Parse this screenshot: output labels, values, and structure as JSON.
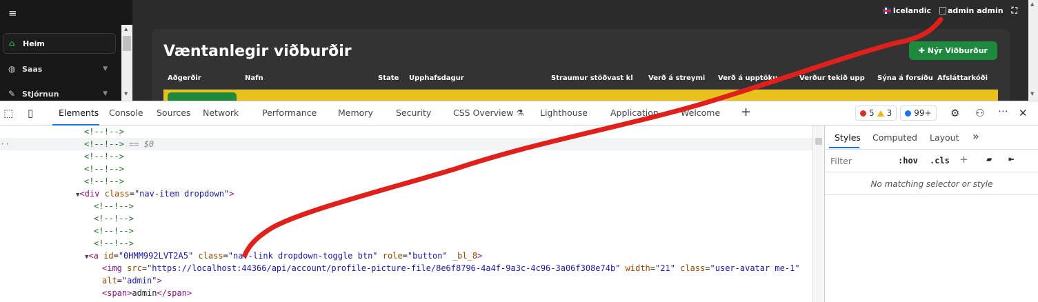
{
  "app": {
    "sidebar": {
      "items": [
        {
          "label": "Heim",
          "icon": "home-icon"
        },
        {
          "label": "Saas",
          "icon": "globe-icon"
        },
        {
          "label": "Stjórnun",
          "icon": "wrench-icon"
        }
      ]
    },
    "topbar": {
      "language": "Icelandic",
      "user_alt": "admin",
      "user_name": "admin"
    },
    "card": {
      "title": "Væntanlegir viðburðir",
      "new_button": "Nýr Viðburður",
      "columns": [
        "Aðgerðir",
        "Nafn",
        "State",
        "Upphafsdagur",
        "Straumur stöðvast kl",
        "Verð á streymi",
        "Verð á upptöku",
        "Verður tekið upp",
        "Sýna á forsíðu",
        "Afsláttarkóði"
      ]
    }
  },
  "devtools": {
    "tabs": [
      "Elements",
      "Console",
      "Sources",
      "Network",
      "Performance",
      "Memory",
      "Security",
      "CSS Overview",
      "Lighthouse",
      "Application",
      "Welcome"
    ],
    "active_tab": "Elements",
    "errors": "5",
    "warnings": "3",
    "messages": "99+",
    "elements": {
      "comment": "<!--!-->",
      "selected_suffix": "== $0",
      "ellipsis": "··",
      "div_tag": "div",
      "div_class_attr": "class",
      "div_class_val": "\"nav-item dropdown\"",
      "a_tag": "a",
      "a_id_attr": "id",
      "a_id_val": "\"0HMM992LVT2A5\"",
      "a_class_attr": "class",
      "a_class_val": "\"nav-link dropdown-toggle btn\"",
      "a_role_attr": "role",
      "a_role_val": "\"button\"",
      "a_extra_attr": "_bl_8",
      "img_tag": "img",
      "img_src_attr": "src",
      "img_src_val": "\"https://localhost:44366/api/account/profile-picture-file/8e6f8796-4a4f-9a3c-4c96-3a06f308e74b\"",
      "img_width_attr": "width",
      "img_width_val": "\"21\"",
      "img_class_attr": "class",
      "img_class_val": "\"user-avatar me-1\"",
      "img_alt_attr": "alt",
      "img_alt_val": "\"admin\"",
      "span_tag": "span",
      "span_text": "admin"
    },
    "styles_panel": {
      "tabs": [
        "Styles",
        "Computed",
        "Layout"
      ],
      "filter_placeholder": "Filter",
      "hov": ":hov",
      "cls": ".cls",
      "empty_message": "No matching selector or style"
    }
  },
  "colors": {
    "annotation_stroke": "#e0201b",
    "accent_green": "#1d8a3e",
    "row_yellow": "#e8c11d",
    "devtools_blue": "#1a73e8"
  }
}
